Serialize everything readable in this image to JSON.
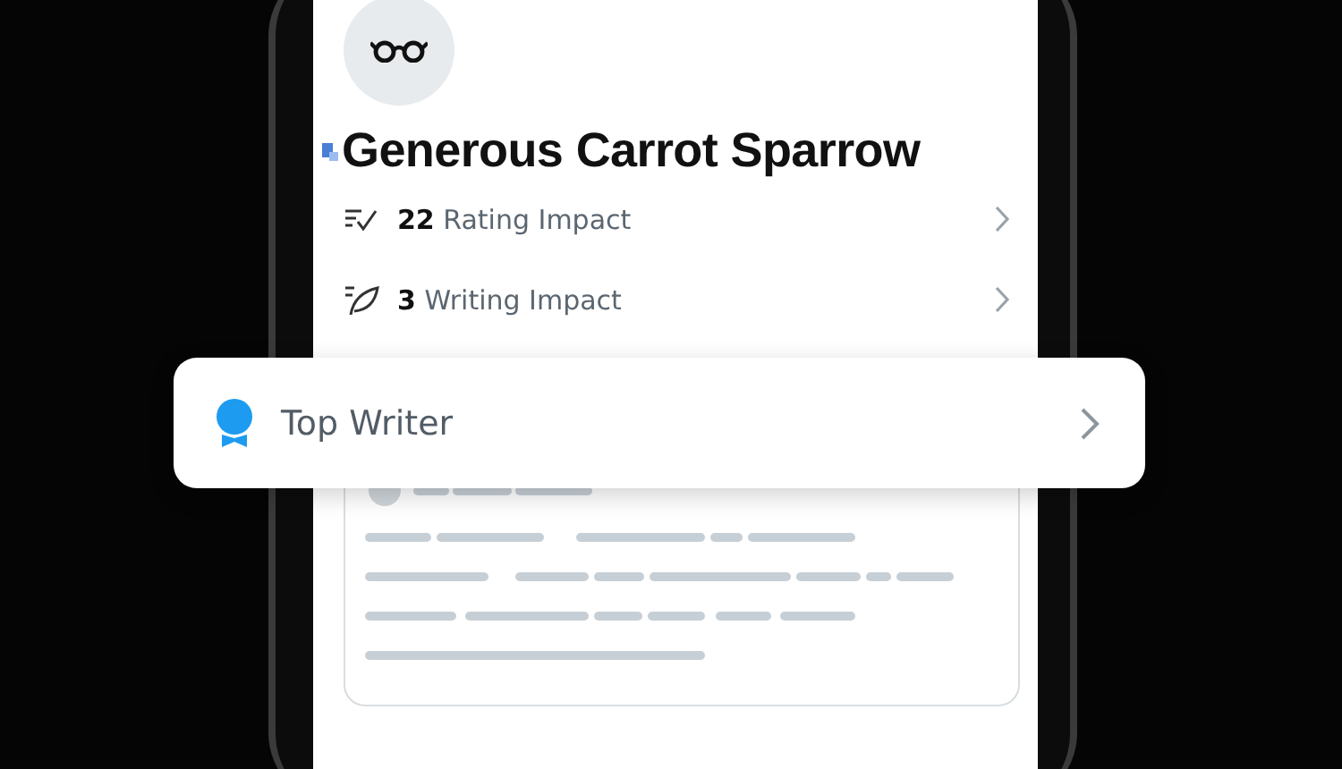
{
  "profile": {
    "name": "Generous Carrot Sparrow"
  },
  "stats": [
    {
      "kind": "rating",
      "count": "22",
      "label": "Rating Impact"
    },
    {
      "kind": "writing",
      "count": "3",
      "label": "Writing Impact"
    }
  ],
  "badge": {
    "label": "Top Writer"
  }
}
